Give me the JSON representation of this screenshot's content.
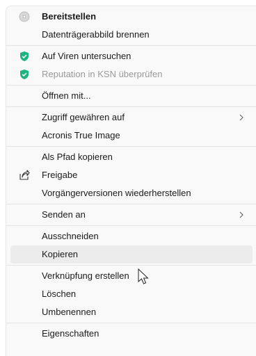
{
  "menu": {
    "group1": [
      {
        "label": "Bereitstellen",
        "icon": "disc-icon"
      },
      {
        "label": "Datenträgerabbild brennen"
      }
    ],
    "group2": [
      {
        "label": "Auf Viren untersuchen",
        "icon": "kaspersky-shield-icon"
      },
      {
        "label": "Reputation in KSN überprüfen",
        "icon": "kaspersky-shield-icon",
        "disabled": true
      }
    ],
    "group3": [
      {
        "label": "Öffnen mit..."
      }
    ],
    "group4": [
      {
        "label": "Zugriff gewähren auf",
        "submenu": true
      },
      {
        "label": "Acronis True Image"
      }
    ],
    "group5": [
      {
        "label": "Als Pfad kopieren"
      },
      {
        "label": "Freigabe",
        "icon": "share-icon"
      },
      {
        "label": "Vorgängerversionen wiederherstellen"
      }
    ],
    "group6": [
      {
        "label": "Senden an",
        "submenu": true
      }
    ],
    "group7": [
      {
        "label": "Ausschneiden"
      },
      {
        "label": "Kopieren",
        "hovered": true
      }
    ],
    "group8": [
      {
        "label": "Verknüpfung erstellen"
      },
      {
        "label": "Löschen"
      },
      {
        "label": "Umbenennen"
      }
    ],
    "group9": [
      {
        "label": "Eigenschaften"
      }
    ]
  },
  "colors": {
    "menu_bg": "#f9f9f9",
    "hover_bg": "#ececec",
    "kaspersky_green": "#1bb37e",
    "disabled_text": "#9a9a9a"
  }
}
